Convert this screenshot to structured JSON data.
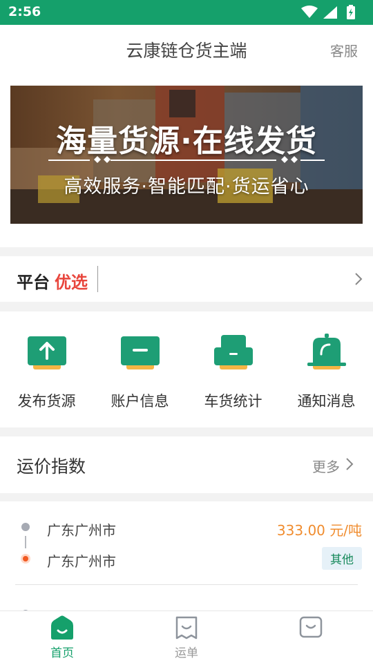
{
  "statusbar": {
    "time": "2:56"
  },
  "header": {
    "title": "云康链仓货主端",
    "service": "客服"
  },
  "banner": {
    "title": "海量货源·在线发货",
    "subtitle": "高效服务·智能匹配·货运省心"
  },
  "platform": {
    "label_a": "平台",
    "label_b": "优选"
  },
  "quick_actions": [
    {
      "label": "发布货源",
      "icon": "upload-box-icon"
    },
    {
      "label": "账户信息",
      "icon": "account-box-icon"
    },
    {
      "label": "车货统计",
      "icon": "truck-icon"
    },
    {
      "label": "通知消息",
      "icon": "bell-icon"
    }
  ],
  "price_index": {
    "title": "运价指数",
    "more": "更多"
  },
  "routes": [
    {
      "from": "广东广州市",
      "to": "广东广州市",
      "price": "333.00 元/吨",
      "tag": "其他"
    }
  ],
  "tabs": [
    {
      "label": "首页",
      "active": true
    },
    {
      "label": "运单",
      "active": false
    },
    {
      "label": "",
      "active": false
    }
  ],
  "colors": {
    "brand": "#15a06b",
    "accent_yellow": "#f5b544",
    "price_orange": "#f08c2e",
    "highlight_red": "#e8453c"
  }
}
